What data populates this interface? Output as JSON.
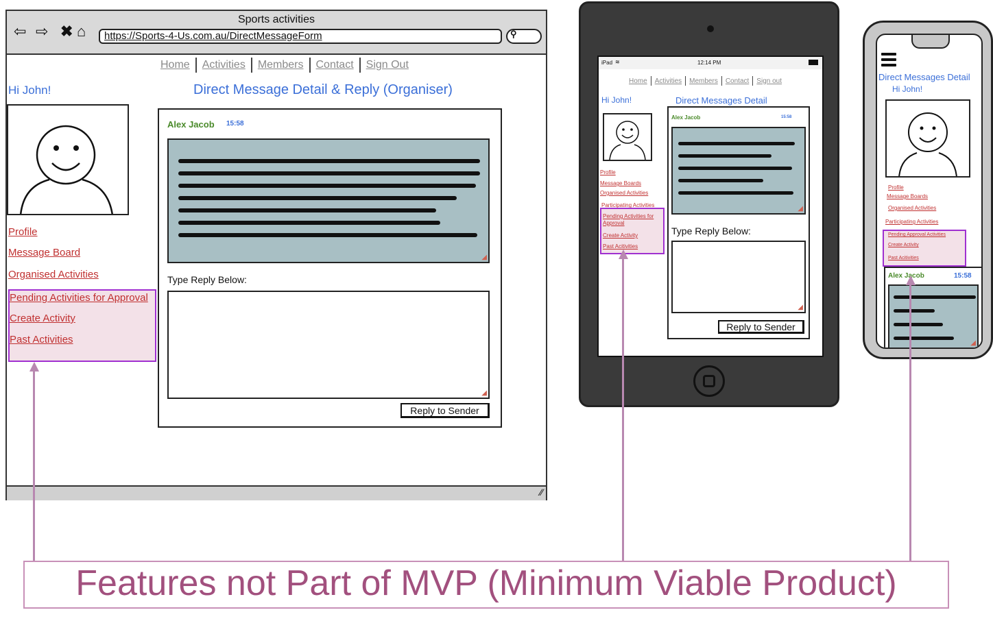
{
  "desktop": {
    "window_title": "Sports activities",
    "url": "https://Sports-4-Us.com.au/DirectMessageForm",
    "nav": [
      "Home",
      "Activities",
      "Members",
      "Contact",
      "Sign Out"
    ],
    "greeting": "Hi John!",
    "page_title": "Direct Message Detail & Reply (Organiser)",
    "sidebar": [
      "Profile",
      "Message Board",
      "Organised Activities",
      "Pending Activities for Approval",
      "Create Activity",
      "Past Activities"
    ],
    "message": {
      "sender": "Alex Jacob",
      "time": "15:58"
    },
    "reply_label": "Type Reply Below:",
    "reply_button": "Reply to Sender"
  },
  "tablet": {
    "status_left": "iPad",
    "status_time": "12:14 PM",
    "nav": [
      "Home",
      "Activities",
      "Members",
      "Contact",
      "Sign out"
    ],
    "greeting": "Hi John!",
    "page_title": "Direct Messages Detail",
    "sidebar": [
      "Profile",
      "Message Boards",
      "Organised Activities",
      "Participating Activities",
      "Pending Activities for Approval",
      "Create Activity",
      "Past Acitivities"
    ],
    "message": {
      "sender": "Alex Jacob",
      "time": "15:58"
    },
    "reply_label": "Type Reply Below:",
    "reply_button": "Reply to Sender"
  },
  "phone": {
    "page_title": "Direct Messages Detail",
    "greeting": "Hi John!",
    "sidebar": [
      "Profile",
      "Message Boards",
      "Organised Activities",
      "Participating Activities",
      "Pending Approval Activities",
      "Create Activity",
      "Past Acitivities"
    ],
    "message": {
      "sender": "Alex Jacob",
      "time": "15:58"
    }
  },
  "annotation": "Features not Part of MVP (Minimum Viable Product)",
  "colors": {
    "link": "#c03030",
    "title": "#3b6fd8",
    "highlight_border": "#a030d0",
    "annotation": "#a2507e",
    "message_bg": "#a8bfc4"
  }
}
